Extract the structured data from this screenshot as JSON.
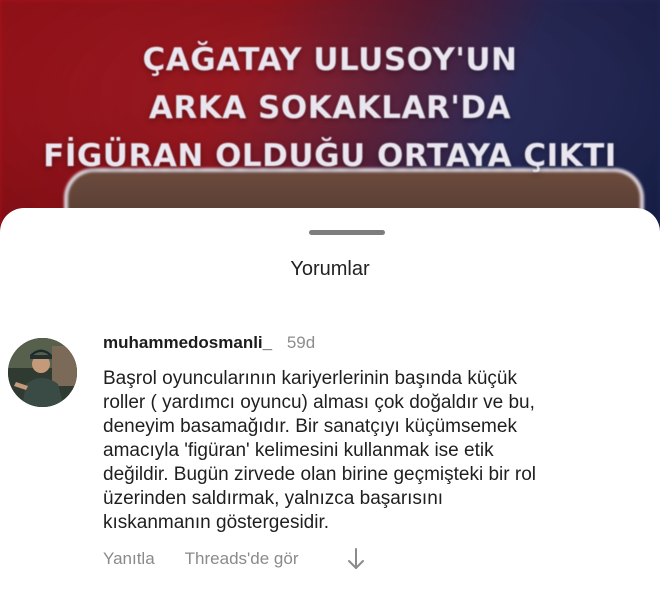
{
  "background_post": {
    "headline_lines": [
      "ÇAĞATAY ULUSOY'UN",
      "ARKA SOKAKLAR'DA",
      "FİGÜRAN OLDUĞU ORTAYA ÇIKTI"
    ]
  },
  "sheet": {
    "title": "Yorumlar"
  },
  "comment": {
    "username": "muhammedosmanli_",
    "age": "59d",
    "body_lines": [
      "Başrol oyuncularının kariyerlerinin başında küçük",
      "roller ( yardımcı oyuncu) alması çok doğaldır ve bu,",
      "deneyim basamağıdır. Bir sanatçıyı küçümsemek",
      "amacıyla 'figüran' kelimesini kullanmak ise etik",
      "değildir. Bugün zirvede olan birine geçmişteki bir rol",
      "üzerinden saldırmak, yalnızca başarısını",
      "kıskanmanın göstergesidir."
    ],
    "actions": {
      "reply_label": "Yanıtla",
      "threads_label": "Threads'de gör",
      "more_icon": "arrow-down-icon"
    }
  },
  "colors": {
    "backdrop_red": "#b3121b",
    "backdrop_blue": "#1b2558",
    "muted_text": "#8a8a8a",
    "handle": "#7d7d7d"
  }
}
